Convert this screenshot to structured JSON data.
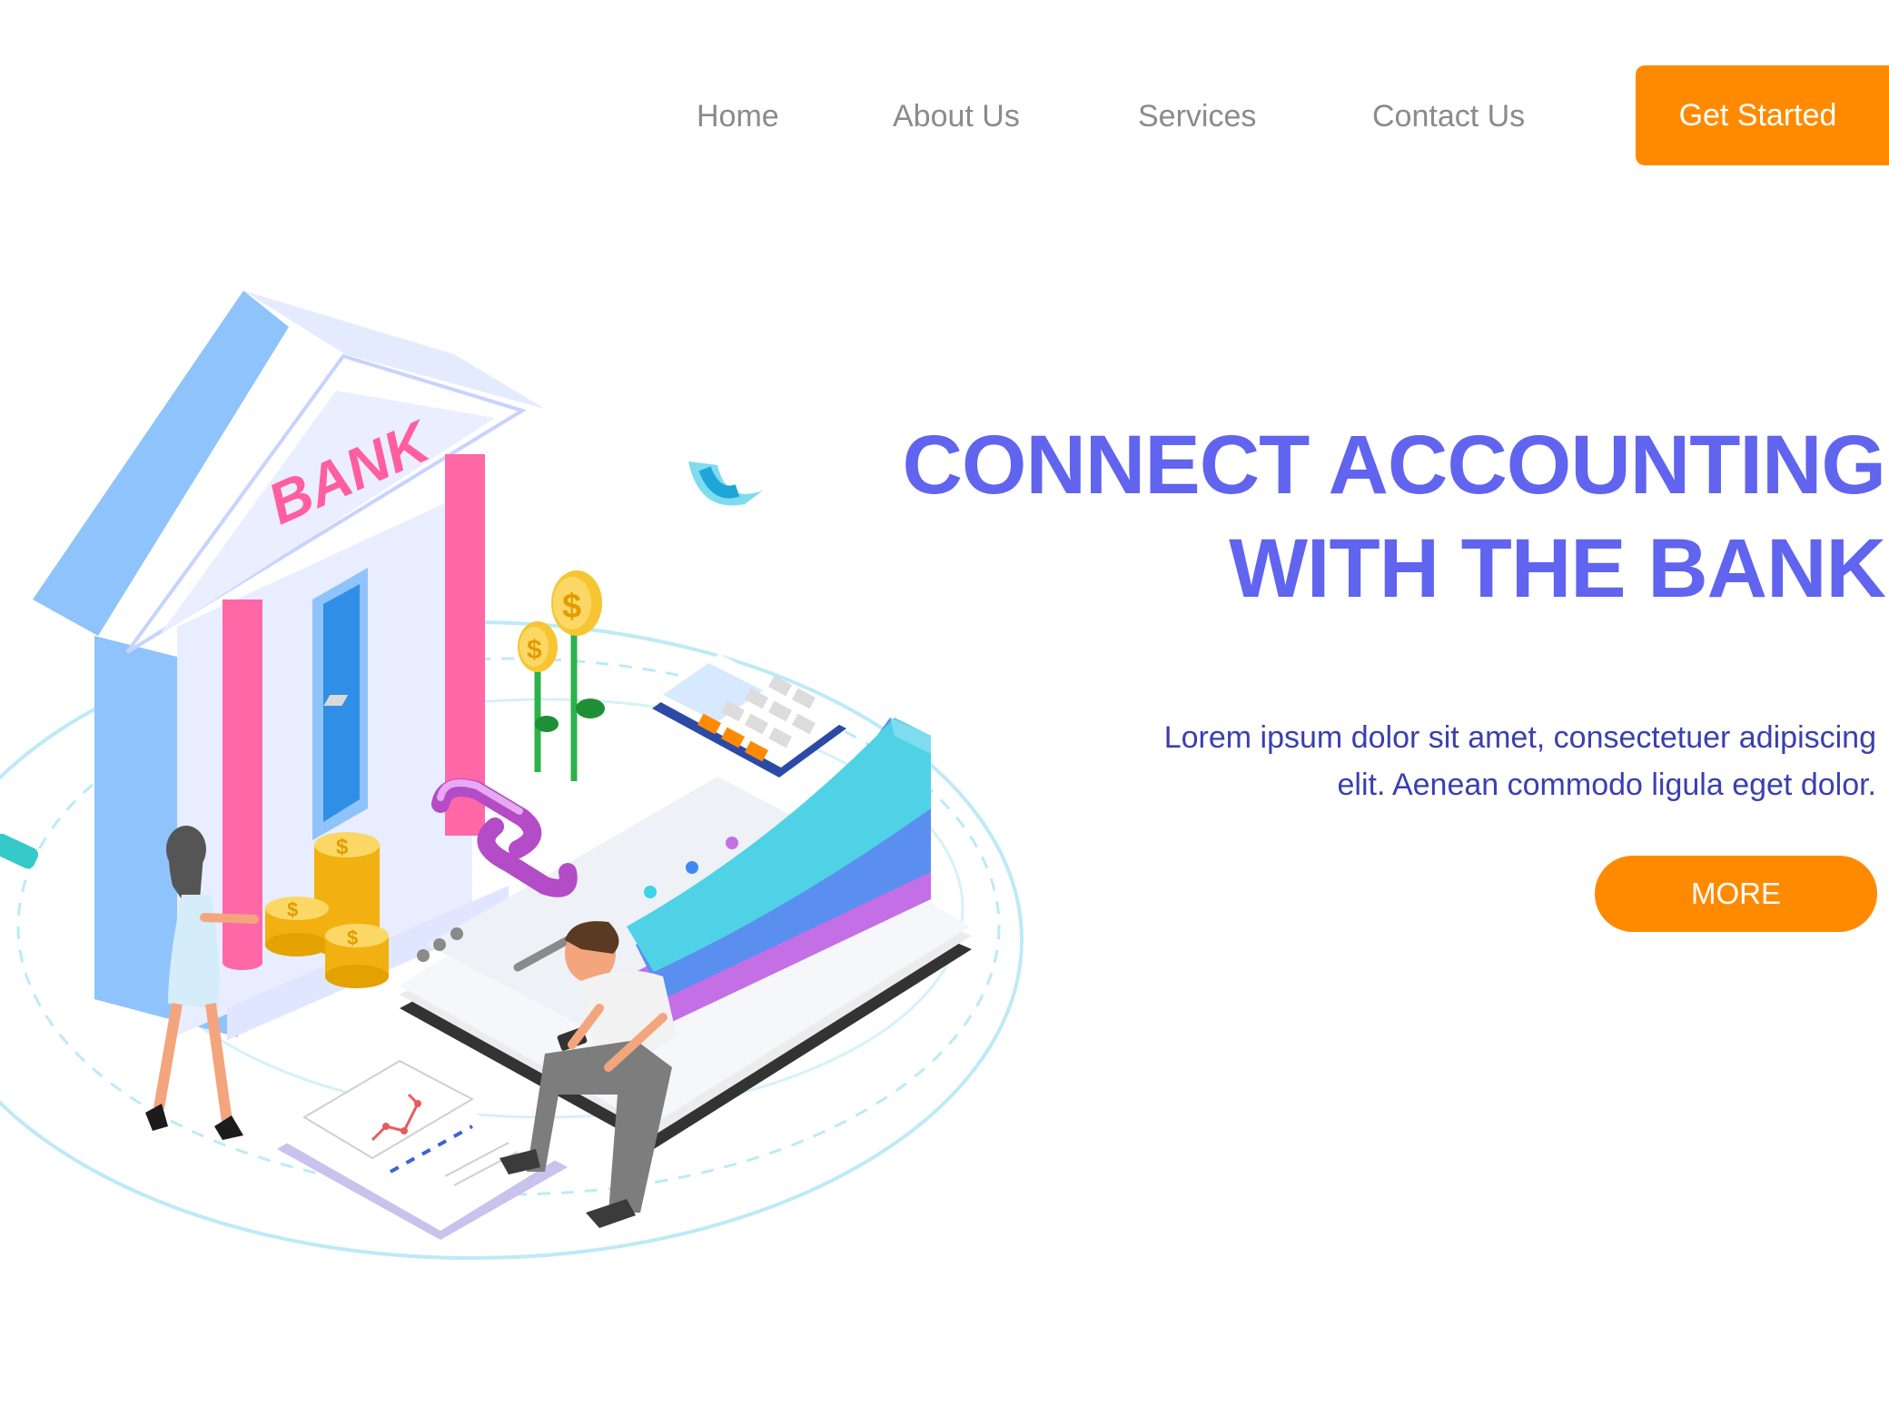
{
  "nav": {
    "home": "Home",
    "about": "About Us",
    "services": "Services",
    "contact": "Contact Us",
    "cta": "Get Started"
  },
  "hero": {
    "title_line1": "CONNECT ACCOUNTING",
    "title_line2": "WITH THE BANK",
    "desc_line1": "Lorem ipsum dolor sit amet, consectetuer adipiscing",
    "desc_line2": "elit. Aenean commodo ligula eget dolor.",
    "more": "MORE"
  },
  "illustration": {
    "bank_sign": "BANK",
    "coin_symbol": "$"
  },
  "colors": {
    "accent_orange": "#ff8a00",
    "title_blue": "#6064ef",
    "desc_blue": "#3a3fb0",
    "nav_gray": "#8a8a8f"
  }
}
